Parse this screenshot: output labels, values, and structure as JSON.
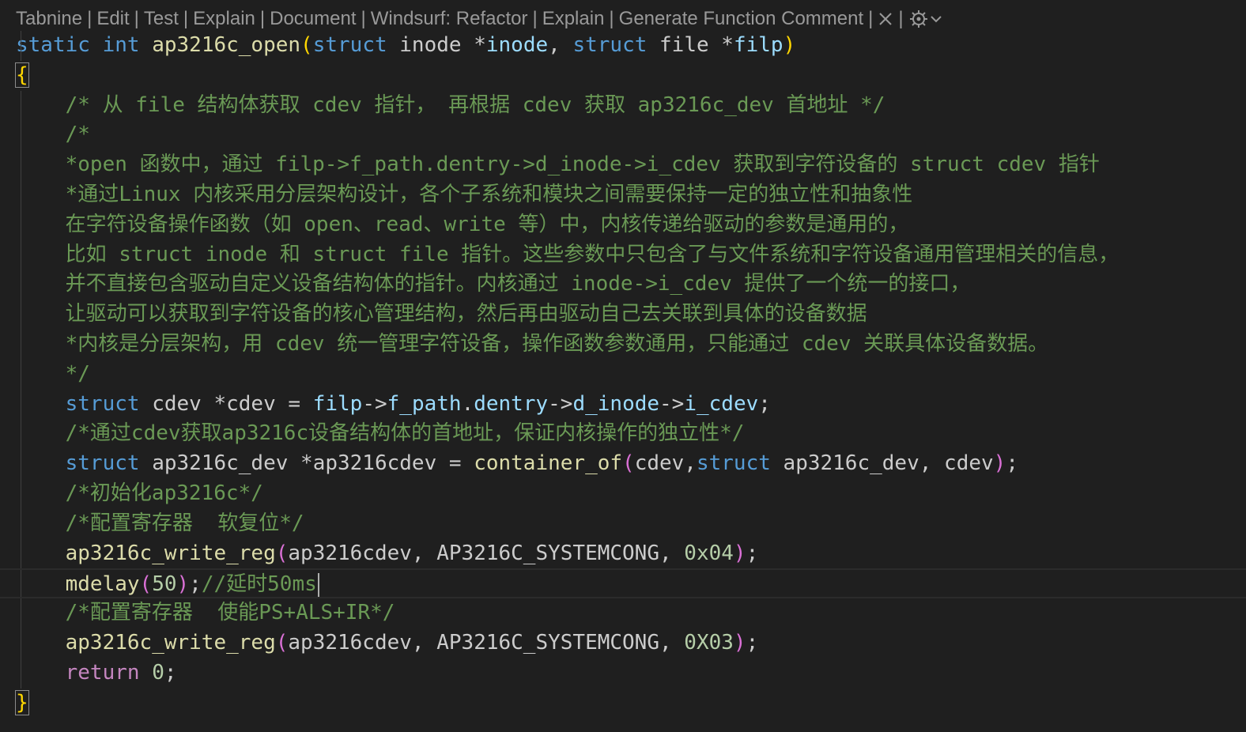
{
  "codelens": {
    "items": [
      "Tabnine",
      "Edit",
      "Test",
      "Explain",
      "Document",
      "Windsurf: Refactor",
      "Explain",
      "Generate Function Comment"
    ],
    "separator": "|",
    "close_icon": "close-icon",
    "settings_icon": "windsurf-settings-icon",
    "dropdown_icon": "chevron-down-icon"
  },
  "code": {
    "lines": [
      [
        [
          "kw",
          "static"
        ],
        [
          "txt",
          " "
        ],
        [
          "kw",
          "int"
        ],
        [
          "txt",
          " "
        ],
        [
          "fn",
          "ap3216c_open"
        ],
        [
          "p1",
          "("
        ],
        [
          "kw",
          "struct"
        ],
        [
          "txt",
          " inode *"
        ],
        [
          "var",
          "inode"
        ],
        [
          "txt",
          ", "
        ],
        [
          "kw",
          "struct"
        ],
        [
          "txt",
          " file *"
        ],
        [
          "var",
          "filp"
        ],
        [
          "p1",
          ")"
        ]
      ],
      [
        [
          "brace",
          "{"
        ]
      ],
      [
        [
          "txt",
          "    "
        ],
        [
          "cm",
          "/* 从 file 结构体获取 cdev 指针， 再根据 cdev 获取 ap3216c_dev 首地址 */"
        ]
      ],
      [
        [
          "txt",
          "    "
        ],
        [
          "cm",
          "/*"
        ]
      ],
      [
        [
          "txt",
          "    "
        ],
        [
          "cm",
          "*open 函数中，通过 filp->f_path.dentry->d_inode->i_cdev 获取到字符设备的 struct cdev 指针"
        ]
      ],
      [
        [
          "txt",
          "    "
        ],
        [
          "cm",
          "*通过Linux 内核采用分层架构设计，各个子系统和模块之间需要保持一定的独立性和抽象性"
        ]
      ],
      [
        [
          "txt",
          "    "
        ],
        [
          "cm",
          "在字符设备操作函数（如 open、read、write 等）中，内核传递给驱动的参数是通用的，"
        ]
      ],
      [
        [
          "txt",
          "    "
        ],
        [
          "cm",
          "比如 struct inode 和 struct file 指针。这些参数中只包含了与文件系统和字符设备通用管理相关的信息，"
        ]
      ],
      [
        [
          "txt",
          "    "
        ],
        [
          "cm",
          "并不直接包含驱动自定义设备结构体的指针。内核通过 inode->i_cdev 提供了一个统一的接口，"
        ]
      ],
      [
        [
          "txt",
          "    "
        ],
        [
          "cm",
          "让驱动可以获取到字符设备的核心管理结构，然后再由驱动自己去关联到具体的设备数据"
        ]
      ],
      [
        [
          "txt",
          "    "
        ],
        [
          "cm",
          "*内核是分层架构，用 cdev 统一管理字符设备，操作函数参数通用，只能通过 cdev 关联具体设备数据。"
        ]
      ],
      [
        [
          "txt",
          "    "
        ],
        [
          "cm",
          "*/"
        ]
      ],
      [
        [
          "txt",
          "    "
        ],
        [
          "kw",
          "struct"
        ],
        [
          "txt",
          " cdev *cdev = "
        ],
        [
          "var",
          "filp"
        ],
        [
          "txt",
          "->"
        ],
        [
          "var",
          "f_path"
        ],
        [
          "txt",
          "."
        ],
        [
          "var",
          "dentry"
        ],
        [
          "txt",
          "->"
        ],
        [
          "var",
          "d_inode"
        ],
        [
          "txt",
          "->"
        ],
        [
          "var",
          "i_cdev"
        ],
        [
          "txt",
          ";"
        ]
      ],
      [
        [
          "txt",
          "    "
        ],
        [
          "cm",
          "/*通过cdev获取ap3216c设备结构体的首地址，保证内核操作的独立性*/"
        ]
      ],
      [
        [
          "txt",
          "    "
        ],
        [
          "kw",
          "struct"
        ],
        [
          "txt",
          " ap3216c_dev *ap3216cdev = "
        ],
        [
          "fn",
          "container_of"
        ],
        [
          "p2",
          "("
        ],
        [
          "txt",
          "cdev,"
        ],
        [
          "kw",
          "struct"
        ],
        [
          "txt",
          " ap3216c_dev, cdev"
        ],
        [
          "p2",
          ")"
        ],
        [
          "txt",
          ";"
        ]
      ],
      [
        [
          "txt",
          "    "
        ],
        [
          "cm",
          "/*初始化ap3216c*/"
        ]
      ],
      [
        [
          "txt",
          "    "
        ],
        [
          "cm",
          "/*配置寄存器  软复位*/"
        ]
      ],
      [
        [
          "txt",
          "    "
        ],
        [
          "fn",
          "ap3216c_write_reg"
        ],
        [
          "p2",
          "("
        ],
        [
          "txt",
          "ap3216cdev, AP3216C_SYSTEMCONG, "
        ],
        [
          "num",
          "0x04"
        ],
        [
          "p2",
          ")"
        ],
        [
          "txt",
          ";"
        ]
      ],
      [
        [
          "txt",
          "    "
        ],
        [
          "fn",
          "mdelay"
        ],
        [
          "p2",
          "("
        ],
        [
          "num",
          "50"
        ],
        [
          "p2",
          ")"
        ],
        [
          "txt",
          ";"
        ],
        [
          "cm",
          "//延时50ms"
        ]
      ],
      [
        [
          "txt",
          "    "
        ],
        [
          "cm",
          "/*配置寄存器  使能PS+ALS+IR*/"
        ]
      ],
      [
        [
          "txt",
          "    "
        ],
        [
          "fn",
          "ap3216c_write_reg"
        ],
        [
          "p2",
          "("
        ],
        [
          "txt",
          "ap3216cdev, AP3216C_SYSTEMCONG, "
        ],
        [
          "num",
          "0X03"
        ],
        [
          "p2",
          ")"
        ],
        [
          "txt",
          ";"
        ]
      ],
      [
        [
          "txt",
          "    "
        ],
        [
          "ctl",
          "return"
        ],
        [
          "txt",
          " "
        ],
        [
          "num",
          "0"
        ],
        [
          "txt",
          ";"
        ]
      ],
      [
        [
          "brace",
          "}"
        ]
      ]
    ]
  }
}
